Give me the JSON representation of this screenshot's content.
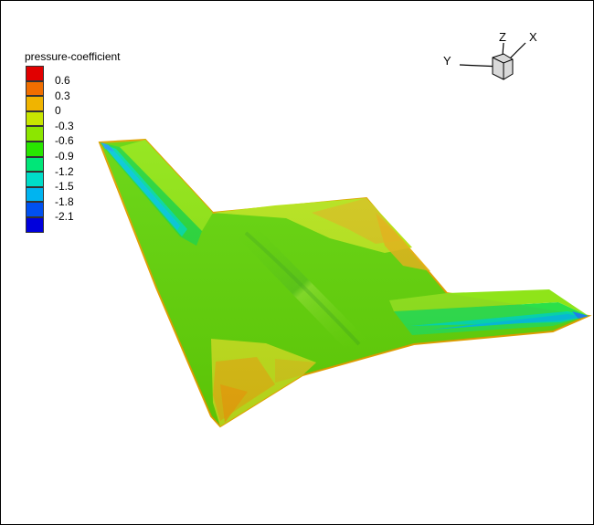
{
  "legend": {
    "title": "pressure-coefficient",
    "levels": [
      {
        "label": "0.6",
        "color": "#e10000"
      },
      {
        "label": "0.3",
        "color": "#f06e00"
      },
      {
        "label": "0",
        "color": "#f0b400"
      },
      {
        "label": "-0.3",
        "color": "#c8e600"
      },
      {
        "label": "-0.6",
        "color": "#8ce600"
      },
      {
        "label": "-0.9",
        "color": "#28e600"
      },
      {
        "label": "-1.2",
        "color": "#00e678"
      },
      {
        "label": "-1.5",
        "color": "#00dcc8"
      },
      {
        "label": "-1.8",
        "color": "#00b4f0"
      },
      {
        "label": "-2.1",
        "color": "#0050f0"
      },
      {
        "label": "",
        "color": "#0000dc"
      }
    ]
  },
  "axes": {
    "x": "X",
    "y": "Y",
    "z": "Z"
  }
}
